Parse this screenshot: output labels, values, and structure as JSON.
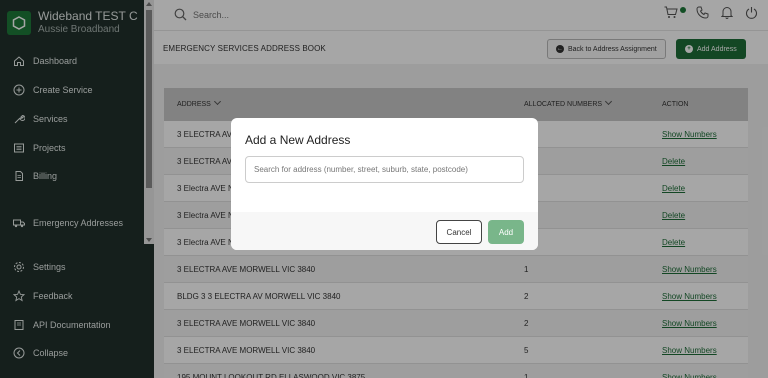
{
  "brand": {
    "title": "Wideband TEST C...",
    "subtitle": "Aussie Broadband"
  },
  "sidebar": {
    "items": [
      {
        "label": "Dashboard",
        "icon": "home-icon"
      },
      {
        "label": "Create Service",
        "icon": "plus-circle-icon"
      },
      {
        "label": "Services",
        "icon": "wrench-icon"
      },
      {
        "label": "Projects",
        "icon": "list-box-icon"
      },
      {
        "label": "Billing",
        "icon": "document-icon"
      },
      {
        "label": "Emergency Addresses",
        "icon": "truck-icon"
      },
      {
        "label": "Settings",
        "icon": "gear-icon"
      },
      {
        "label": "Feedback",
        "icon": "star-icon"
      },
      {
        "label": "API Documentation",
        "icon": "book-icon"
      },
      {
        "label": "Collapse",
        "icon": "chevron-left-circle-icon"
      }
    ]
  },
  "search": {
    "placeholder": "Search..."
  },
  "header": {
    "title": "EMERGENCY SERVICES ADDRESS BOOK",
    "back_label": "Back to Address Assignment",
    "add_label": "Add Address"
  },
  "table": {
    "columns": [
      "ADDRESS",
      "ALLOCATED NUMBERS",
      "ACTION"
    ],
    "rows": [
      {
        "address": "3 ELECTRA AV",
        "numbers": "",
        "action": "Show Numbers"
      },
      {
        "address": "3 ELECTRA AV",
        "numbers": "",
        "action": "Delete"
      },
      {
        "address": "3 Electra AVE N",
        "numbers": "",
        "action": "Delete"
      },
      {
        "address": "3 Electra AVE N",
        "numbers": "",
        "action": "Delete"
      },
      {
        "address": "3 Electra AVE N",
        "numbers": "",
        "action": "Delete"
      },
      {
        "address": "3 ELECTRA AVE MORWELL VIC 3840",
        "numbers": "1",
        "action": "Show Numbers"
      },
      {
        "address": "BLDG 3 3 ELECTRA AV MORWELL VIC 3840",
        "numbers": "2",
        "action": "Show Numbers"
      },
      {
        "address": "3 ELECTRA AVE MORWELL VIC 3840",
        "numbers": "2",
        "action": "Show Numbers"
      },
      {
        "address": "3 ELECTRA AVE MORWELL VIC 3840",
        "numbers": "5",
        "action": "Show Numbers"
      },
      {
        "address": "195 MOUNT LOOKOUT RD ELLASWOOD VIC 3875",
        "numbers": "1",
        "action": "Show Numbers"
      }
    ]
  },
  "modal": {
    "title": "Add a New Address",
    "input_placeholder": "Search for address (number, street, suburb, state, postcode)",
    "input_value": "",
    "cancel_label": "Cancel",
    "add_label": "Add"
  },
  "colors": {
    "brand_green": "#1e6e38",
    "sidebar_bg": "#21302c",
    "disabled_add": "#79b68a"
  }
}
